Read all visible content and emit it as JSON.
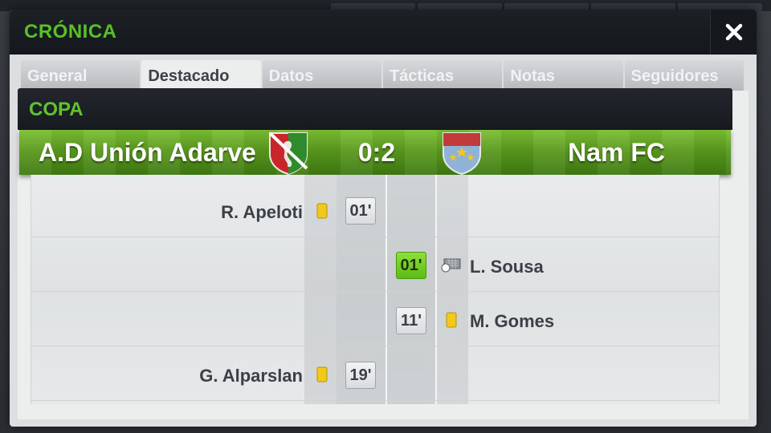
{
  "window": {
    "title": "CRÓNICA"
  },
  "tabs": [
    {
      "label": "General",
      "active": false
    },
    {
      "label": "Destacado",
      "active": true
    },
    {
      "label": "Datos",
      "active": false
    },
    {
      "label": "Tácticas",
      "active": false
    },
    {
      "label": "Notas",
      "active": false
    },
    {
      "label": "Seguidores",
      "active": false
    }
  ],
  "match": {
    "competition": "COPA",
    "home_team": "A.D Unión Adarve",
    "away_team": "Nam FC",
    "score": "0:2",
    "home_crest_icon": "shield-crest-red-green-icon",
    "away_crest_icon": "shield-crest-red-blue-stars-icon"
  },
  "events": [
    {
      "side": "home",
      "player": "R. Apeloti",
      "minute": "01'",
      "type": "yellow-card"
    },
    {
      "side": "away",
      "player": "L. Sousa",
      "minute": "01'",
      "type": "goal"
    },
    {
      "side": "away",
      "player": "M. Gomes",
      "minute": "11'",
      "type": "yellow-card"
    },
    {
      "side": "home",
      "player": "G. Alparslan",
      "minute": "19'",
      "type": "yellow-card"
    }
  ],
  "colors": {
    "accent_green": "#58c02a",
    "goal_green": "#6fd020",
    "yellow_card": "#f2c81a"
  }
}
